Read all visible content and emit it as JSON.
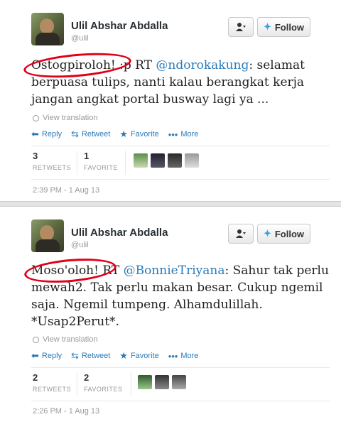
{
  "tweets": [
    {
      "name": "Ulil Abshar Abdalla",
      "handle": "@ulil",
      "follow_label": "Follow",
      "text_lead": "Ostogpiroloh! :p RT ",
      "mention": "@ndorokakung",
      "text_rest": ": selamat berpuasa tulips, nanti kalau berangkat kerja jangan angkat portal busway lagi ya ...",
      "view_translation": "View translation",
      "actions": {
        "reply": "Reply",
        "retweet": "Retweet",
        "favorite": "Favorite",
        "more": "More"
      },
      "retweets": "3",
      "retweets_label": "RETWEETS",
      "favorites": "1",
      "favorites_label": "FAVORITE",
      "timestamp": "2:39 PM - 1 Aug 13"
    },
    {
      "name": "Ulil Abshar Abdalla",
      "handle": "@ulil",
      "follow_label": "Follow",
      "text_lead": "Moso'oloh! RT ",
      "mention": "@BonnieTriyana",
      "text_rest": ": Sahur tak perlu mewah2. Tak perlu makan besar. Cukup ngemil saja. Ngemil tumpeng. Alhamdulillah. *Usap2Perut*.",
      "view_translation": "View translation",
      "actions": {
        "reply": "Reply",
        "retweet": "Retweet",
        "favorite": "Favorite",
        "more": "More"
      },
      "retweets": "2",
      "retweets_label": "RETWEETS",
      "favorites": "2",
      "favorites_label": "FAVORITES",
      "timestamp": "2:26 PM - 1 Aug 13"
    }
  ],
  "colors": {
    "link": "#2b7bb9",
    "highlight_oval": "#e0001a",
    "twitter_blue": "#2fa4e7"
  }
}
